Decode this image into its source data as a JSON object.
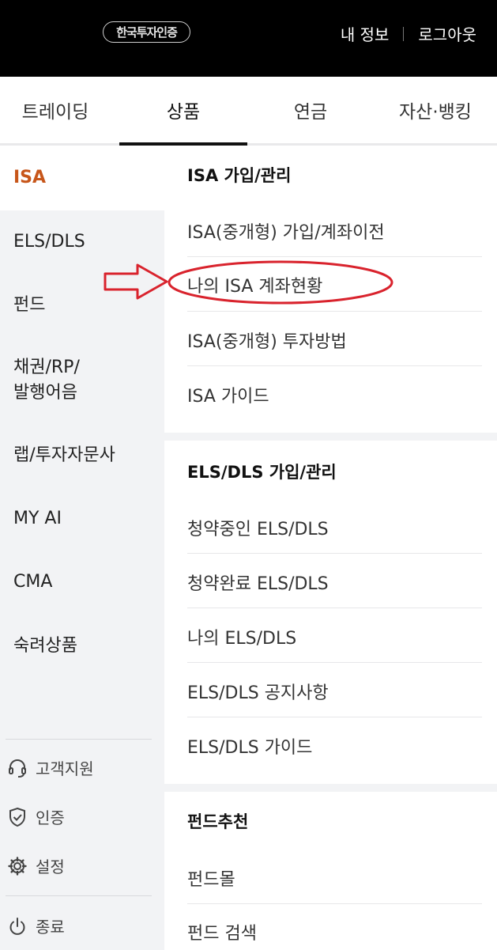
{
  "header": {
    "logo_text": "한국투자인증",
    "my_info": "내 정보",
    "logout": "로그아웃"
  },
  "tabs": [
    {
      "label": "트레이딩"
    },
    {
      "label": "상품"
    },
    {
      "label": "연금"
    },
    {
      "label": "자산·뱅킹"
    }
  ],
  "sidebar": {
    "items": [
      {
        "label": "ISA"
      },
      {
        "label": "ELS/DLS"
      },
      {
        "label": "펀드"
      },
      {
        "label": "채권/RP/\n발행어음"
      },
      {
        "label": "랩/투자자문사"
      },
      {
        "label": "MY AI"
      },
      {
        "label": "CMA"
      },
      {
        "label": "숙려상품"
      }
    ],
    "utils": [
      {
        "label": "고객지원",
        "icon": "headset-icon"
      },
      {
        "label": "인증",
        "icon": "shield-check-icon"
      },
      {
        "label": "설정",
        "icon": "gear-icon"
      },
      {
        "label": "종료",
        "icon": "power-icon"
      }
    ]
  },
  "sections": [
    {
      "title": "ISA 가입/관리",
      "items": [
        "ISA(중개형) 가입/계좌이전",
        "나의 ISA 계좌현황",
        "ISA(중개형) 투자방법",
        "ISA 가이드"
      ]
    },
    {
      "title": "ELS/DLS 가입/관리",
      "items": [
        "청약중인 ELS/DLS",
        "청약완료 ELS/DLS",
        "나의 ELS/DLS",
        "ELS/DLS 공지사항",
        "ELS/DLS 가이드"
      ]
    },
    {
      "title": "펀드추천",
      "items": [
        "펀드몰",
        "펀드 검색"
      ]
    }
  ],
  "colors": {
    "accent": "#c7561a",
    "annotation": "#d9232d",
    "header_bg": "#000000",
    "sidebar_bg": "#f2f3f5"
  }
}
